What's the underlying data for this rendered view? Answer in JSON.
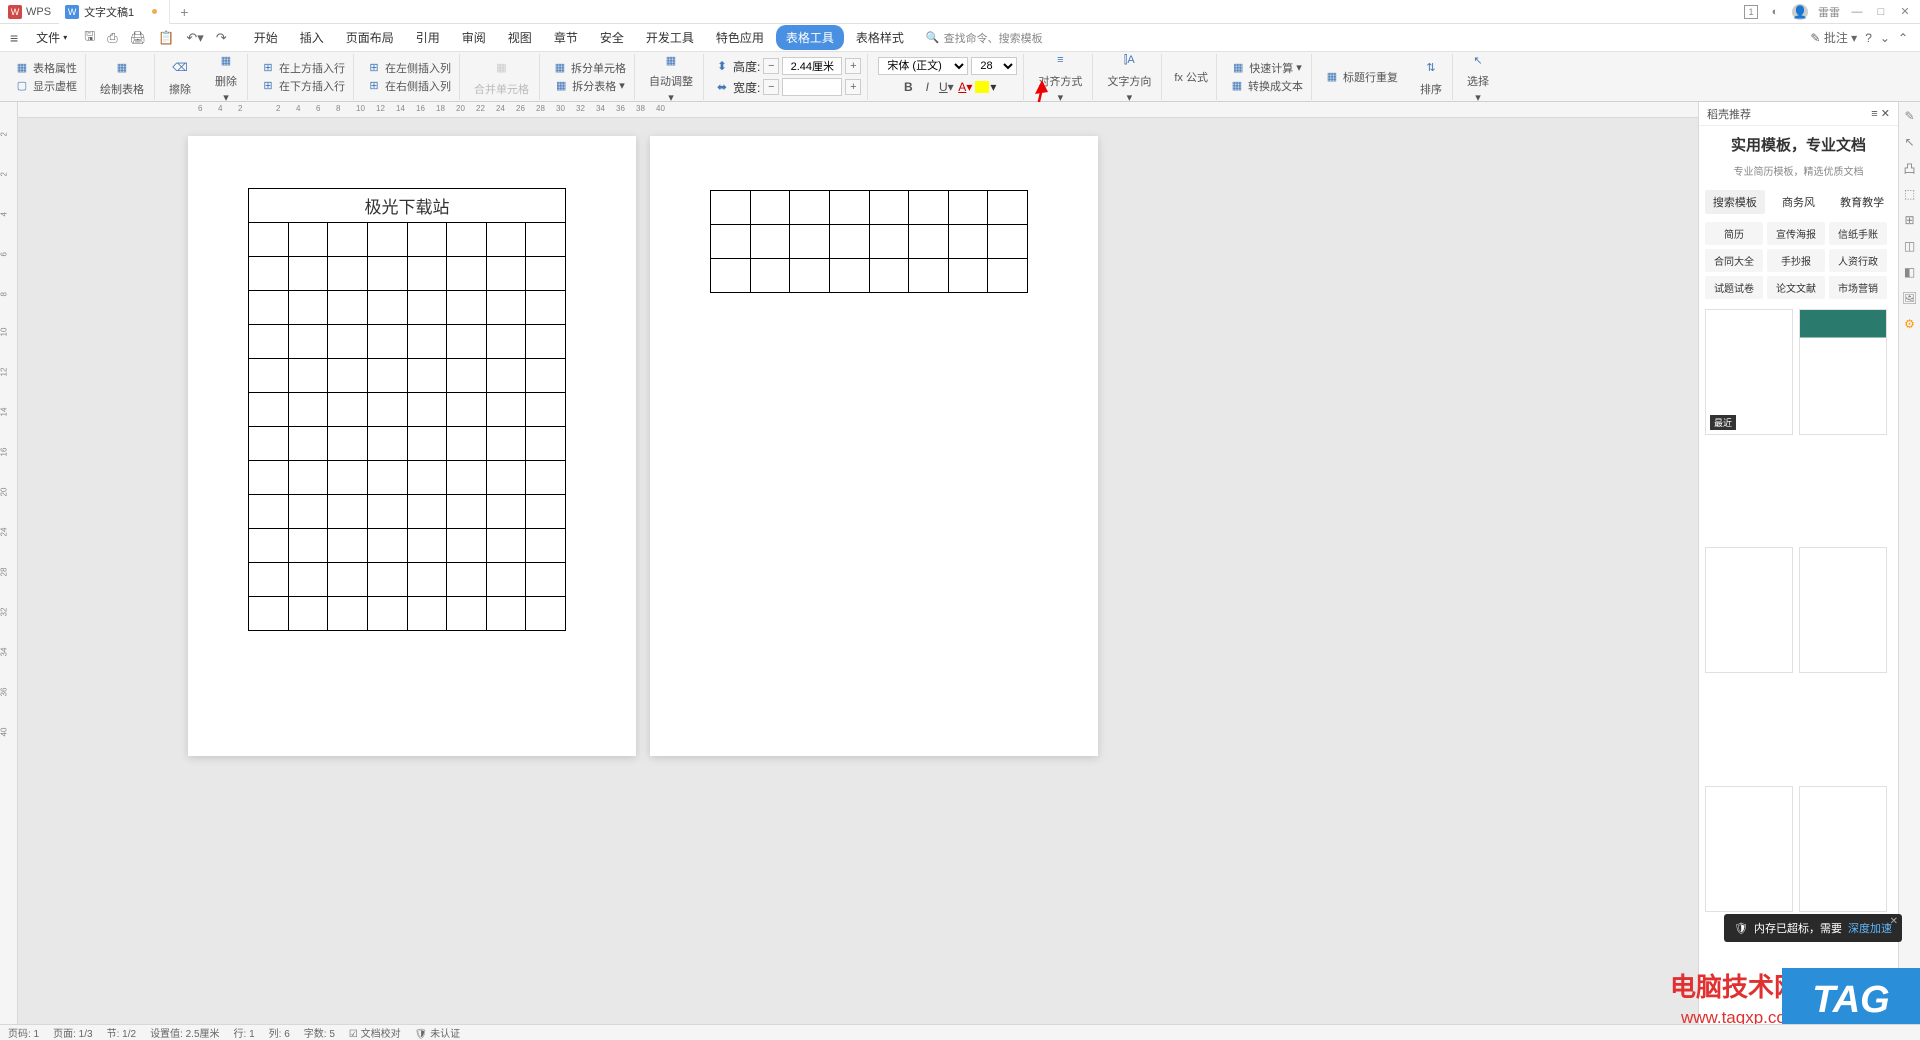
{
  "title": {
    "app": "WPS",
    "doc": "文字文稿1"
  },
  "file_menu": "文件",
  "menu": [
    "开始",
    "插入",
    "页面布局",
    "引用",
    "审阅",
    "视图",
    "章节",
    "安全",
    "开发工具",
    "特色应用",
    "表格工具",
    "表格样式"
  ],
  "menu_active": 10,
  "search": {
    "label": "查找命令、搜索模板"
  },
  "qat_right": {
    "approve": "批注"
  },
  "ribbon": {
    "props": "表格属性",
    "show": "显示虚框",
    "draw": "绘制表格",
    "erase": "擦除",
    "del": "删除",
    "ins_top": "在上方插入行",
    "ins_bot": "在下方插入行",
    "ins_left": "在左侧插入列",
    "ins_right": "在右侧插入列",
    "merge": "合并单元格",
    "split_cell": "拆分单元格",
    "split_tbl": "拆分表格",
    "auto": "自动调整",
    "height": "高度:",
    "width": "宽度:",
    "h_val": "2.44厘米",
    "w_val": "",
    "font": "宋体 (正文)",
    "size": "28",
    "align": "对齐方式",
    "dir": "文字方向",
    "fx": "fx 公式",
    "calc": "快速计算",
    "header_repeat": "标题行重复",
    "to_text": "转换成文本",
    "sort": "排序",
    "select": "选择"
  },
  "doc": {
    "title": "极光下载站"
  },
  "side": {
    "header": "稻壳推荐",
    "title": "实用模板，专业文档",
    "sub": "专业简历模板，精选优质文档",
    "tabs": [
      "搜索模板",
      "商务风",
      "教育教学"
    ],
    "cats": [
      "简历",
      "宣传海报",
      "信纸手账",
      "合同大全",
      "手抄报",
      "人资行政",
      "试题试卷",
      "论文文献",
      "市场营销"
    ],
    "badge": "最近"
  },
  "notif": {
    "text": "内存已超标，需要",
    "link": "深度加速"
  },
  "status": {
    "page_no": "页码: 1",
    "pages": "页面: 1/3",
    "sec": "节: 1/2",
    "pos": "设置值: 2.5厘米",
    "row": "行: 1",
    "col": "列: 6",
    "words": "字数: 5",
    "spell": "文档校对",
    "auth": "未认证"
  },
  "wm": {
    "t1": "电脑技术网",
    "t2": "www.tagxp.com",
    "tag": "TAG"
  },
  "user": "雷雷"
}
